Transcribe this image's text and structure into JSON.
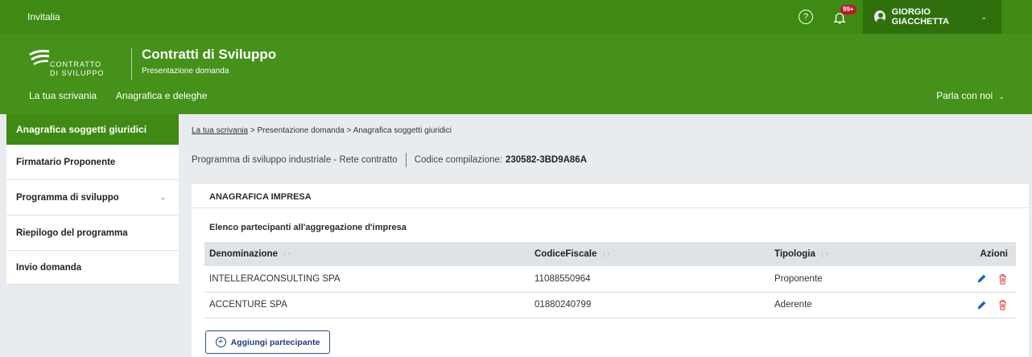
{
  "topbar": {
    "brand": "Invitalia",
    "help_icon": "?",
    "notification_badge": "99+",
    "user_name": "GIORGIO GIACCHETTA",
    "user_caret": "⌄"
  },
  "header": {
    "logo_line1": "CONTRATTO",
    "logo_line2": "DI SVILUPPO",
    "title": "Contratti di Sviluppo",
    "subtitle": "Presentazione domanda",
    "nav": [
      "La tua scrivania",
      "Anagrafica e deleghe"
    ],
    "parla": "Parla con noi",
    "parla_caret": "⌄"
  },
  "sidebar": {
    "active": "Anagrafica soggetti giuridici",
    "items": [
      {
        "label": "Firmatario Proponente"
      },
      {
        "label": "Programma di sviluppo",
        "chevron": "⌄"
      },
      {
        "label": "Riepilogo del programma"
      },
      {
        "label": "Invio domanda"
      }
    ]
  },
  "breadcrumb": {
    "link": "La tua scrivania",
    "rest": " > Presentazione domanda  > Anagrafica soggetti giuridici"
  },
  "programma": {
    "text": "Programma di sviluppo industriale  -  Rete contratto",
    "codice_label": "Codice compilazione:",
    "codice_value": "230582-3BD9A86A"
  },
  "card": {
    "title": "ANAGRAFICA IMPRESA",
    "subtitle": "Elenco partecipanti all'aggregazione d'impresa",
    "sort_glyph": "↓↑",
    "columns": [
      "Denominazione",
      "CodiceFiscale",
      "Tipologia",
      "Azioni"
    ],
    "rows": [
      {
        "denominazione": "INTELLERACONSULTING SPA",
        "codice_fiscale": "11088550964",
        "tipologia": "Proponente"
      },
      {
        "denominazione": "ACCENTURE SPA",
        "codice_fiscale": "01880240799",
        "tipologia": "Aderente"
      }
    ],
    "add_button": "Aggiungi partecipante",
    "add_icon": "+"
  },
  "colors": {
    "topbar": "#3e8a12",
    "header": "#45911a",
    "user_box": "#2f6f0c",
    "accent_blue": "#1f3d7a",
    "delete_red": "#d9534f",
    "badge_red": "#c0122c"
  }
}
